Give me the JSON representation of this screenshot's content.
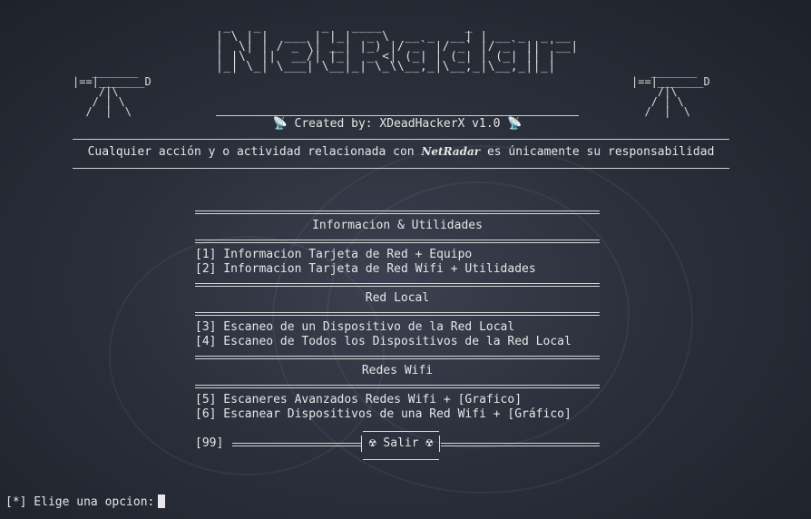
{
  "banner": {
    "ascii": " _   _        _   ____           _            \n| \\ | |  ___ | |_|  _ \\  __ _  __| | __ _  _ __ \n|  \\| | / _ \\| __| |_) |/ _` |/ _` |/ _` || '__|\n| |\\  ||  __/| |_|  _ <| (_| | (_| | (_| || |   \n|_| \\_| \\___| \\__|_| \\_\\\\__,_|\\__,_|\\__,_||_|   ",
    "turret": "   _______   \n|==|_______D\n    /|\\      \n   / | \\     \n  /  |  \\    ",
    "credit": "📡  Created by: XDeadHackerX v1.0  📡"
  },
  "notice": {
    "before": "Cualquier acción y o actividad relacionada con ",
    "brand": "NetRadar",
    "after": " es únicamente su responsabilidad"
  },
  "menu": {
    "section1": "Informacion & Utilidades",
    "item1": "[1] Informacion Tarjeta de Red + Equipo",
    "item2": "[2] Informacion Tarjeta de Red Wifi + Utilidades",
    "section2": "Red  Local",
    "item3": "[3] Escaneo de un Dispositivo de la Red Local",
    "item4": "[4] Escaneo de Todos los Dispositivos de la Red Local",
    "section3": "Redes Wifi",
    "item5": "[5] Escaneres Avanzados Redes Wifi + [Grafico]",
    "item6": "[6] Escanear Dispositivos de una Red Wifi + [Gráfico]",
    "exit_code": "[99]",
    "exit_label": "☢ Salir ☢"
  },
  "prompt": "[*] Elige una opcion:"
}
